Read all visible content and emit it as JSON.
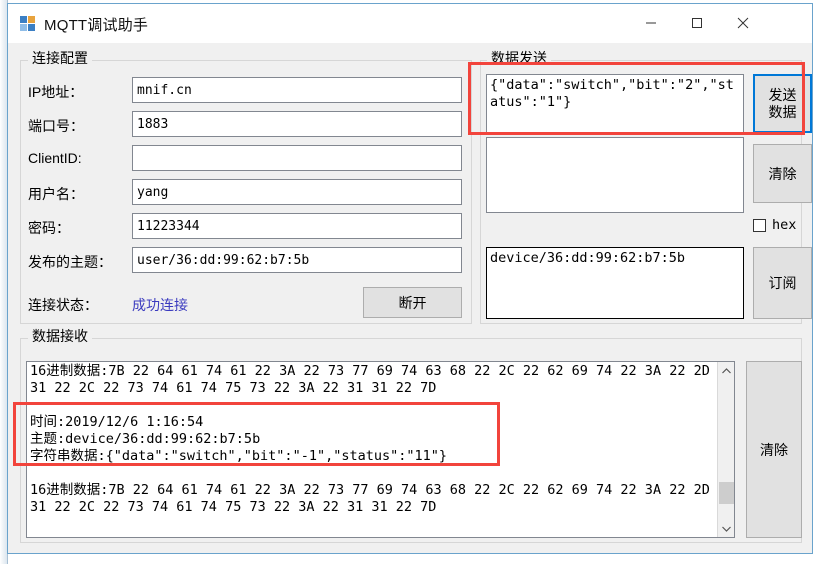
{
  "window": {
    "title": "MQTT调试助手",
    "icon": "app-window-icon",
    "controls": {
      "minimize": "−",
      "maximize": "□",
      "close": "✕"
    }
  },
  "connection": {
    "group_label": "连接配置",
    "fields": [
      {
        "label": "IP地址：",
        "value": "mnif.cn"
      },
      {
        "label": "端口号：",
        "value": "1883"
      },
      {
        "label": "ClientID:",
        "value": ""
      },
      {
        "label": "用户名：",
        "value": "yang"
      },
      {
        "label": "密码：",
        "value": "11223344"
      },
      {
        "label": "发布的主题：",
        "value": "user/36:dd:99:62:b7:5b"
      }
    ],
    "status_label": "连接状态：",
    "status_value": "成功连接",
    "status_color": "#3b3bbf",
    "disconnect_button": "断开"
  },
  "send": {
    "group_label": "数据发送",
    "payload": "{\"data\":\"switch\",\"bit\":\"2\",\"status\":\"1\"}",
    "send_button": "发送\n数据",
    "clear_button": "清除",
    "hex_label": "hex",
    "hex_checked": false,
    "subscribe_topic": "device/36:dd:99:62:b7:5b",
    "subscribe_button": "订阅",
    "second_box_value": ""
  },
  "receive": {
    "group_label": "数据接收",
    "clear_button": "清除",
    "log": "16进制数据:7B 22 64 61 74 61 22 3A 22 73 77 69 74 63 68 22 2C 22 62 69 74 22 3A 22 2D\n31 22 2C 22 73 74 61 74 75 73 22 3A 22 31 31 22 7D\n\n时间:2019/12/6 1:16:54\n主题:device/36:dd:99:62:b7:5b\n字符串数据:{\"data\":\"switch\",\"bit\":\"-1\",\"status\":\"11\"}\n\n16进制数据:7B 22 64 61 74 61 22 3A 22 73 77 69 74 63 68 22 2C 22 62 69 74 22 3A 22 2D\n31 22 2C 22 73 74 61 74 75 73 22 3A 22 31 31 22 7D",
    "scrollbar": {
      "up_arrow": "⌃",
      "down_arrow": "⌄"
    }
  },
  "annotations": {
    "highlight_color": "#f2443c",
    "boxes": [
      {
        "name": "send-payload-highlight"
      },
      {
        "name": "received-message-highlight"
      }
    ]
  }
}
